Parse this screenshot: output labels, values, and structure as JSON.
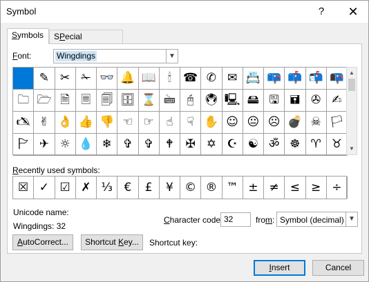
{
  "window": {
    "title": "Symbol",
    "help_glyph": "?",
    "close_glyph": "✕"
  },
  "tabs": [
    {
      "label": "Symbols",
      "mnemonic": "S",
      "rest": "ymbols",
      "active": true
    },
    {
      "label": "Special Characters",
      "mnemonic": "P",
      "pre": "S",
      "rest": "ecial Characters",
      "active": false
    }
  ],
  "font": {
    "label_mn": "F",
    "label_rest": "ont:",
    "value": "Wingdings"
  },
  "symbol_grid": {
    "rows": [
      [
        "",
        "✎",
        "✂",
        "✁",
        "👓",
        "🔔",
        "📖",
        "🕯",
        "☎",
        "✆",
        "✉",
        "📇",
        "📪",
        "📫",
        "📬",
        "📭"
      ],
      [
        "🗀",
        "🗁",
        "🗎",
        "🗏",
        "🗐",
        "🗄",
        "⌛",
        "🖮",
        "🖰",
        "🖲",
        "🖳",
        "🖴",
        "🖫",
        "🖬",
        "✇",
        "✍"
      ],
      [
        "🖎",
        "✌",
        "👌",
        "👍",
        "👎",
        "☜",
        "☞",
        "☝",
        "☟",
        "✋",
        "☺",
        "😐",
        "☹",
        "💣",
        "☠",
        "🏳"
      ],
      [
        "🏱",
        "✈",
        "☼",
        "💧",
        "❄",
        "✞",
        "✞",
        "🕈",
        "✠",
        "✡",
        "☪",
        "☯",
        "ॐ",
        "☸",
        "♈",
        "♉"
      ]
    ],
    "selected_index": 0
  },
  "recent": {
    "label_mn": "R",
    "label_rest": "ecently used symbols:",
    "symbols": [
      "☒",
      "✓",
      "☑",
      "✗",
      "⅓",
      "€",
      "£",
      "¥",
      "©",
      "®",
      "™",
      "±",
      "≠",
      "≤",
      "≥",
      "÷"
    ]
  },
  "unicode_name": {
    "label": "Unicode name:",
    "value": "Wingdings: 32"
  },
  "character_code": {
    "label_mn": "C",
    "label_rest": "haracter code:",
    "value": "32"
  },
  "from": {
    "label_pre": "fro",
    "label_mn": "m",
    "label_rest": ":",
    "value": "Symbol (decimal)"
  },
  "buttons": {
    "autocorrect": {
      "mn": "A",
      "rest": "utoCorrect..."
    },
    "shortcut_key": {
      "pre": "Shortcut ",
      "mn": "K",
      "rest": "ey..."
    },
    "insert": {
      "mn": "I",
      "rest": "nsert"
    },
    "cancel": "Cancel"
  },
  "shortcut_key_label": "Shortcut key:",
  "colors": {
    "selection": "#0078d7",
    "default_button_border": "#0078d7",
    "highlight": "#cce4f7"
  }
}
